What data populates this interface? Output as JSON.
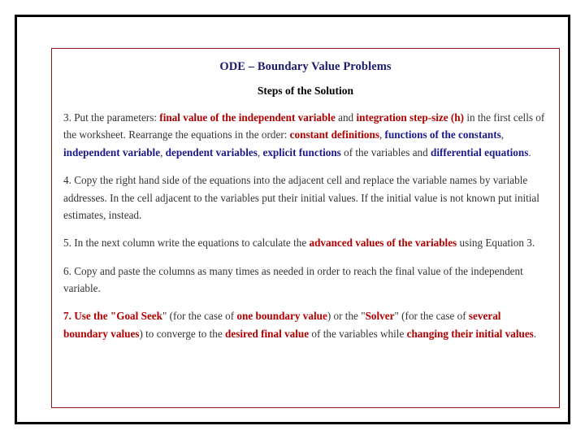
{
  "slide": {
    "title": "ODE – Boundary Value Problems",
    "subtitle": "Steps of the Solution",
    "colors": {
      "title": "#1a1a6e",
      "highlight_red": "#b00000",
      "highlight_blue": "#1a1a8c",
      "frame_outer": "#000000",
      "frame_inner": "#8b1a1a",
      "body": "#333333"
    },
    "paragraphs": [
      {
        "id": "step-3",
        "runs": [
          {
            "text": "3. Put the parameters: ",
            "style": "plain"
          },
          {
            "text": "final value of the independent variable",
            "style": "red"
          },
          {
            "text": " and ",
            "style": "plain"
          },
          {
            "text": "integration step-size (h)",
            "style": "red"
          },
          {
            "text": " in the first cells of the worksheet. Rearrange the equations in the order: ",
            "style": "plain"
          },
          {
            "text": "constant definitions",
            "style": "red"
          },
          {
            "text": ", ",
            "style": "plain"
          },
          {
            "text": "functions of the constants",
            "style": "blue"
          },
          {
            "text": ", ",
            "style": "plain"
          },
          {
            "text": "independent variable",
            "style": "blue"
          },
          {
            "text": ", ",
            "style": "plain"
          },
          {
            "text": "dependent variables",
            "style": "blue"
          },
          {
            "text": ", ",
            "style": "plain"
          },
          {
            "text": "explicit functions",
            "style": "blue"
          },
          {
            "text": " of the variables and ",
            "style": "plain"
          },
          {
            "text": "differential equations",
            "style": "blue"
          },
          {
            "text": ".",
            "style": "plain"
          }
        ]
      },
      {
        "id": "step-4",
        "runs": [
          {
            "text": "4. Copy the right hand side of the equations into the adjacent cell and replace the variable names by variable addresses. In the cell adjacent to the variables put their initial values. If the initial value is not known put initial estimates, instead.",
            "style": "plain"
          }
        ]
      },
      {
        "id": "step-5",
        "runs": [
          {
            "text": "5. In the next column write the equations to calculate the ",
            "style": "plain"
          },
          {
            "text": "advanced values of the variables",
            "style": "red"
          },
          {
            "text": " using Equation 3.",
            "style": "plain"
          }
        ]
      },
      {
        "id": "step-6",
        "runs": [
          {
            "text": "6. Copy and paste the columns as many times as needed in order to reach the final value of the independent variable.",
            "style": "plain"
          }
        ]
      },
      {
        "id": "step-7",
        "runs": [
          {
            "text": "7. Use the \"",
            "style": "red"
          },
          {
            "text": "Goal Seek",
            "style": "red"
          },
          {
            "text": "\" (for the case of ",
            "style": "plain"
          },
          {
            "text": "one boundary value",
            "style": "red"
          },
          {
            "text": ") or the \"",
            "style": "plain"
          },
          {
            "text": "Solver",
            "style": "red"
          },
          {
            "text": "\" (for the case of ",
            "style": "plain"
          },
          {
            "text": "several boundary values",
            "style": "red"
          },
          {
            "text": ") to converge to the ",
            "style": "plain"
          },
          {
            "text": "desired final value",
            "style": "red"
          },
          {
            "text": " of the variables while ",
            "style": "plain"
          },
          {
            "text": "changing their initial values",
            "style": "red"
          },
          {
            "text": ".",
            "style": "plain"
          }
        ]
      }
    ]
  }
}
